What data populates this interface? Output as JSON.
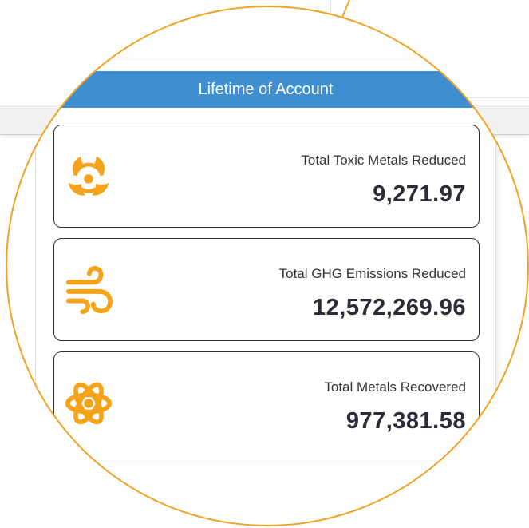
{
  "panel": {
    "title": "Lifetime of Account"
  },
  "stats": [
    {
      "label": "Total Toxic Metals Reduced",
      "value": "9,271.97",
      "icon": "biohazard-icon"
    },
    {
      "label": "Total GHG Emissions Reduced",
      "value": "12,572,269.96",
      "icon": "wind-icon"
    },
    {
      "label": "Total Metals Recovered",
      "value": "977,381.58",
      "icon": "atom-icon"
    }
  ],
  "colors": {
    "header_bg": "#3e8ed0",
    "icon_accent": "#f5a31a",
    "magnifier_ring": "#f0a323"
  }
}
